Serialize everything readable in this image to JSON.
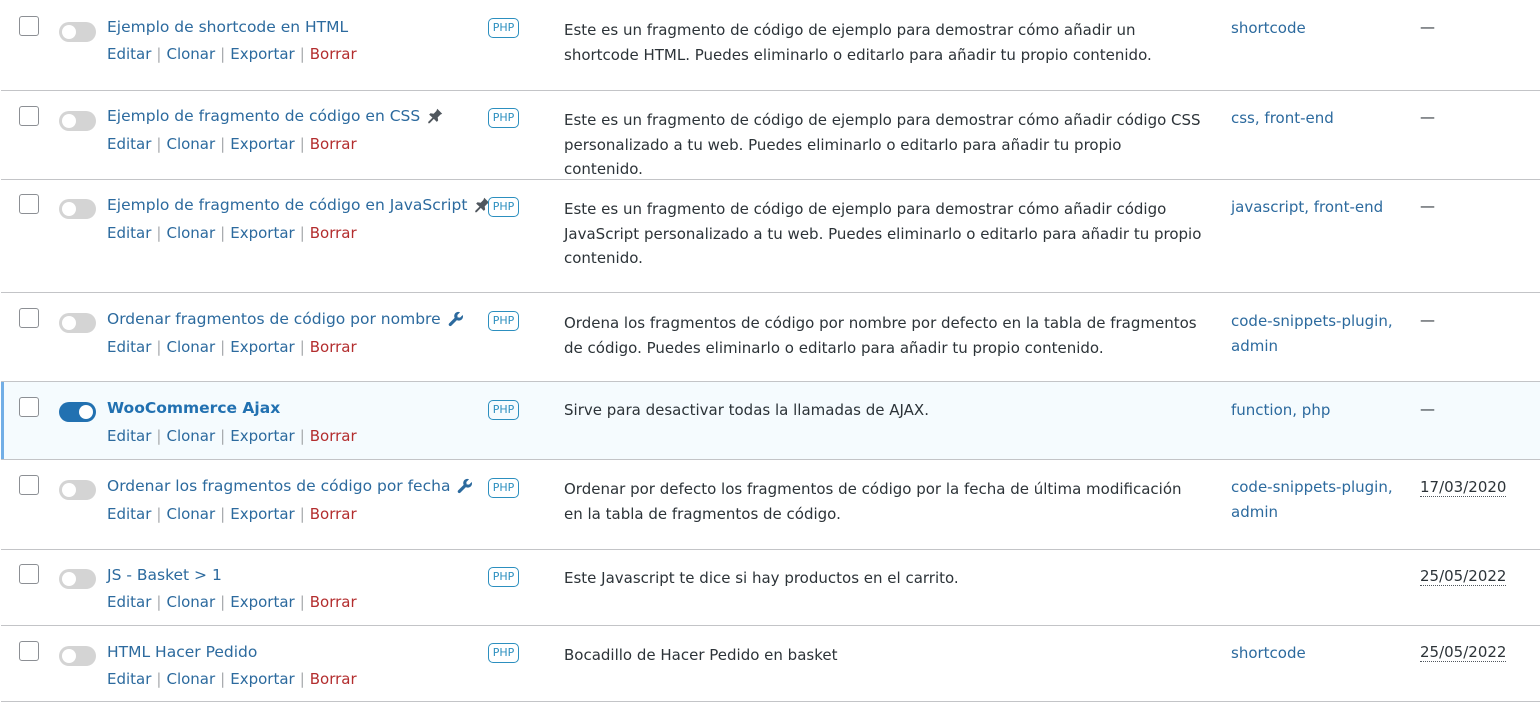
{
  "rows": [
    {
      "name": "Ejemplo de shortcode en HTML",
      "icon": "",
      "active": false,
      "actions": {
        "edit": "Editar",
        "clone": "Clonar",
        "export": "Exportar",
        "delete": "Borrar"
      },
      "type": "PHP",
      "description": "Este es un fragmento de código de ejemplo para demostrar cómo añadir un shortcode HTML. Puedes eliminarlo o editarlo para añadir tu propio contenido.",
      "tags": "shortcode",
      "date": "—"
    },
    {
      "name": "Ejemplo de fragmento de código en CSS",
      "icon": "pin-icon",
      "active": false,
      "actions": {
        "edit": "Editar",
        "clone": "Clonar",
        "export": "Exportar",
        "delete": "Borrar"
      },
      "type": "PHP",
      "description": "Este es un fragmento de código de ejemplo para demostrar cómo añadir código CSS personalizado a tu web. Puedes eliminarlo o editarlo para añadir tu propio contenido.",
      "tags": "css, front-end",
      "date": "—"
    },
    {
      "name": "Ejemplo de fragmento de código en JavaScript",
      "icon": "pin-icon",
      "active": false,
      "actions": {
        "edit": "Editar",
        "clone": "Clonar",
        "export": "Exportar",
        "delete": "Borrar"
      },
      "type": "PHP",
      "description": "Este es un fragmento de código de ejemplo para demostrar cómo añadir código JavaScript personalizado a tu web. Puedes eliminarlo o editarlo para añadir tu propio contenido.",
      "tags": "javascript, front-end",
      "date": "—"
    },
    {
      "name": "Ordenar fragmentos de código por nombre",
      "icon": "wrench-icon",
      "active": false,
      "actions": {
        "edit": "Editar",
        "clone": "Clonar",
        "export": "Exportar",
        "delete": "Borrar"
      },
      "type": "PHP",
      "description": "Ordena los fragmentos de código por nombre por defecto en la tabla de fragmentos de código. Puedes eliminarlo o editarlo para añadir tu propio contenido.",
      "tags": "code-snippets-plugin, admin",
      "date": "—"
    },
    {
      "name": "WooCommerce Ajax",
      "icon": "",
      "active": true,
      "actions": {
        "edit": "Editar",
        "clone": "Clonar",
        "export": "Exportar",
        "delete": "Borrar"
      },
      "type": "PHP",
      "description": "Sirve para desactivar todas la llamadas de AJAX.",
      "tags": "function, php",
      "date": "—"
    },
    {
      "name": "Ordenar los fragmentos de código por fecha",
      "icon": "wrench-icon",
      "active": false,
      "actions": {
        "edit": "Editar",
        "clone": "Clonar",
        "export": "Exportar",
        "delete": "Borrar"
      },
      "type": "PHP",
      "description": "Ordenar por defecto los fragmentos de código por la fecha de última modificación en la tabla de fragmentos de código.",
      "tags": "code-snippets-plugin, admin",
      "date": "17/03/2020"
    },
    {
      "name": "JS - Basket > 1",
      "icon": "",
      "active": false,
      "actions": {
        "edit": "Editar",
        "clone": "Clonar",
        "export": "Exportar",
        "delete": "Borrar"
      },
      "type": "PHP",
      "description": "Este Javascript te dice si hay productos en el carrito.",
      "tags": "",
      "date": "25/05/2022"
    },
    {
      "name": "HTML Hacer Pedido",
      "icon": "",
      "active": false,
      "actions": {
        "edit": "Editar",
        "clone": "Clonar",
        "export": "Exportar",
        "delete": "Borrar"
      },
      "type": "PHP",
      "description": "Bocadillo de Hacer Pedido en basket",
      "tags": "shortcode",
      "date": "25/05/2022"
    }
  ]
}
